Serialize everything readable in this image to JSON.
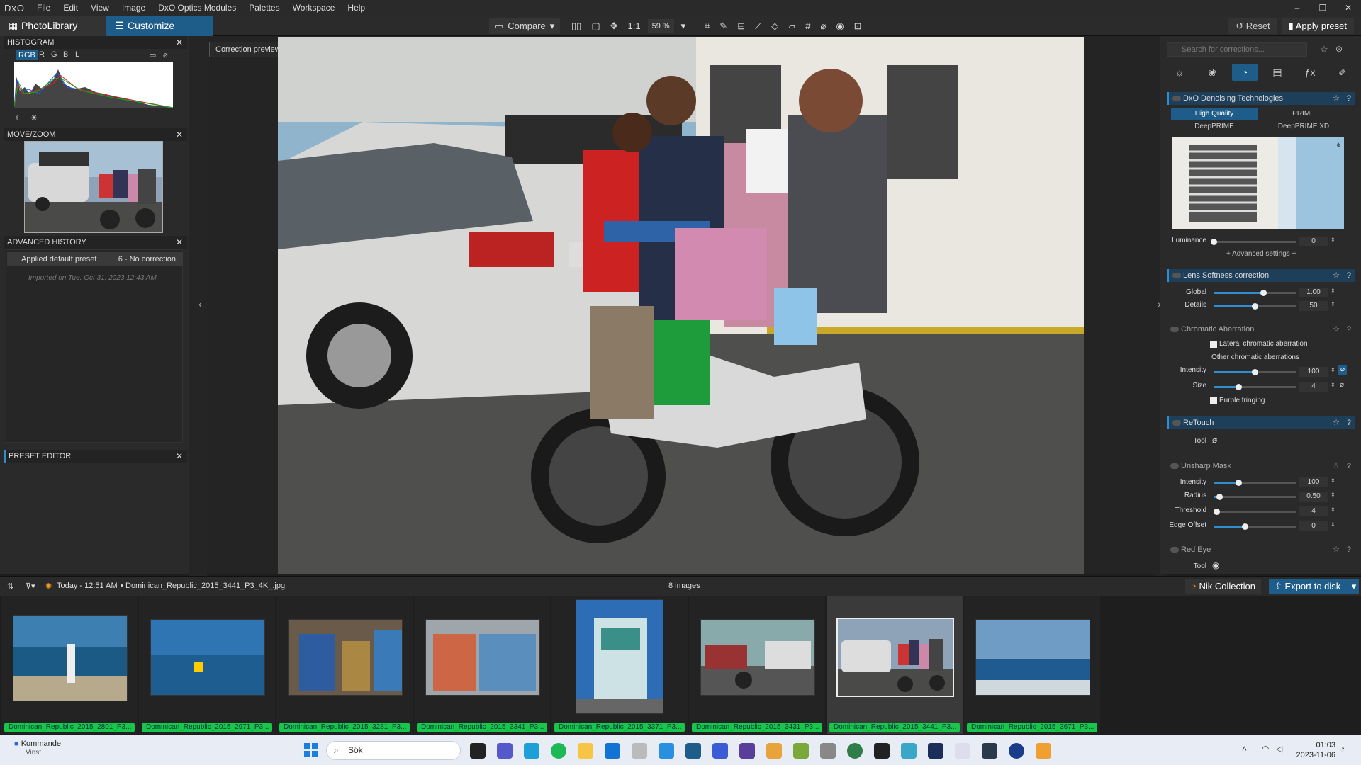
{
  "app": {
    "logo": "DxO"
  },
  "menu": [
    "File",
    "Edit",
    "View",
    "Image",
    "DxO Optics Modules",
    "Palettes",
    "Workspace",
    "Help"
  ],
  "window_controls": [
    "–",
    "❐",
    "✕"
  ],
  "tabs": {
    "photolibrary": "PhotoLibrary",
    "customize": "Customize"
  },
  "toolbar": {
    "compare": "Compare",
    "one_to_one": "1:1",
    "zoom": "59 %",
    "reset": "Reset",
    "apply_preset": "Apply preset"
  },
  "left": {
    "histogram_title": "HISTOGRAM",
    "channels": [
      "RGB",
      "R",
      "G",
      "B",
      "L"
    ],
    "movezoom_title": "MOVE/ZOOM",
    "history_title": "ADVANCED HISTORY",
    "history_item": "Applied default preset",
    "history_item_right": "6 - No correction",
    "history_imported": "Imported on Tue, Oct 31, 2023 12:43 AM",
    "preset_editor_title": "PRESET EDITOR",
    "close": "✕"
  },
  "viewer": {
    "preview_tag": "Correction preview"
  },
  "right": {
    "search_placeholder": "Search for corrections...",
    "denoise": {
      "title": "DxO Denoising Technologies",
      "modes": [
        "High Quality",
        "PRIME",
        "DeepPRIME",
        "DeepPRIME XD"
      ],
      "selected_mode": "High Quality",
      "luminance_label": "Luminance",
      "luminance_value": "0",
      "luminance_level": 0,
      "advanced": "+ Advanced settings +"
    },
    "lens": {
      "title": "Lens Softness correction",
      "global_label": "Global",
      "global_value": "1.00",
      "global_level": 0.6,
      "details_label": "Details",
      "details_value": "50",
      "details_level": 0.5
    },
    "ca": {
      "title": "Chromatic Aberration",
      "lateral": "Lateral chromatic aberration",
      "other": "Other chromatic aberrations",
      "intensity_label": "Intensity",
      "intensity_value": "100",
      "intensity_level": 0.5,
      "size_label": "Size",
      "size_value": "4",
      "size_level": 0.3,
      "purple": "Purple fringing"
    },
    "retouch": {
      "title": "ReTouch",
      "tool_label": "Tool"
    },
    "usm": {
      "title": "Unsharp Mask",
      "intensity_label": "Intensity",
      "intensity_value": "100",
      "intensity_level": 0.3,
      "radius_label": "Radius",
      "radius_value": "0.50",
      "radius_level": 0.07,
      "threshold_label": "Threshold",
      "threshold_value": "4",
      "threshold_level": 0.02,
      "edge_label": "Edge Offset",
      "edge_value": "0",
      "edge_level": 0.38
    },
    "redeye": {
      "title": "Red Eye",
      "tool_label": "Tool"
    }
  },
  "filmbar": {
    "info": "Today - 12:51 AM",
    "filename": "Dominican_Republic_2015_3441_P3_4K_.jpg",
    "count": "8 images",
    "nik": "Nik Collection",
    "export": "Export to disk"
  },
  "thumbnails": [
    {
      "caption": "Dominican_Republic_2015_2801_P3..."
    },
    {
      "caption": "Dominican_Republic_2015_2971_P3..."
    },
    {
      "caption": "Dominican_Republic_2015_3281_P3..."
    },
    {
      "caption": "Dominican_Republic_2015_3341_P3..."
    },
    {
      "caption": "Dominican_Republic_2015_3371_P3..."
    },
    {
      "caption": "Dominican_Republic_2015_3431_P3..."
    },
    {
      "caption": "Dominican_Republic_2015_3441_P3..."
    },
    {
      "caption": "Dominican_Republic_2015_3671_P3..."
    }
  ],
  "taskbar": {
    "weather_title": "Kommande",
    "weather_sub": "Vinst",
    "search": "Sök",
    "time": "01:03",
    "date": "2023-11-06"
  },
  "colors": {
    "accent": "#1e5d8a",
    "caption_green": "#18c64a"
  }
}
